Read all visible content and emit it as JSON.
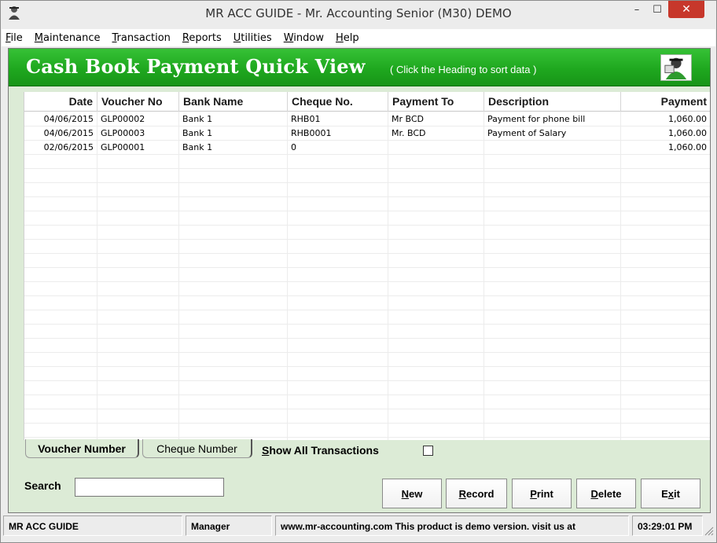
{
  "window": {
    "title": "MR ACC GUIDE - Mr. Accounting Senior (M30) DEMO",
    "minimize_glyph": "–",
    "maximize_glyph": "☐",
    "close_glyph": "✕"
  },
  "menu": [
    {
      "label": "File",
      "accel": "F",
      "rest": "ile"
    },
    {
      "label": "Maintenance",
      "accel": "M",
      "rest": "aintenance"
    },
    {
      "label": "Transaction",
      "accel": "T",
      "rest": "ransaction"
    },
    {
      "label": "Reports",
      "accel": "R",
      "rest": "eports"
    },
    {
      "label": "Utilities",
      "accel": "U",
      "rest": "tilities"
    },
    {
      "label": "Window",
      "accel": "W",
      "rest": "indow"
    },
    {
      "label": "Help",
      "accel": "H",
      "rest": "elp"
    }
  ],
  "header": {
    "title": "Cash Book Payment Quick View",
    "hint": "( Click the Heading to sort data )",
    "icon": "user-agent-icon"
  },
  "table": {
    "columns": [
      "Date",
      "Voucher No",
      "Bank Name",
      "Cheque No.",
      "Payment To",
      "Description",
      "Payment"
    ],
    "rows": [
      [
        "04/06/2015",
        "GLP00002",
        "Bank 1",
        "RHB01",
        "Mr BCD",
        "Payment for phone bill",
        "1,060.00"
      ],
      [
        "04/06/2015",
        "GLP00003",
        "Bank 1",
        "RHB0001",
        "Mr. BCD",
        "Payment of Salary",
        "1,060.00"
      ],
      [
        "02/06/2015",
        "GLP00001",
        "Bank 1",
        "0",
        "",
        "",
        "1,060.00"
      ]
    ]
  },
  "tabs": {
    "voucher": "Voucher Number",
    "cheque": "Cheque Number"
  },
  "show_all": {
    "label": "Show All Transactions",
    "accel": "S",
    "rest": "how All Transactions",
    "checked": false
  },
  "search": {
    "label": "Search",
    "value": ""
  },
  "buttons": {
    "new": {
      "accel": "N",
      "rest": "ew"
    },
    "record": {
      "accel": "R",
      "rest": "ecord"
    },
    "print": {
      "accel": "P",
      "rest": "rint"
    },
    "delete": {
      "accel": "D",
      "rest": "elete"
    },
    "exit": {
      "pre": "E",
      "accel": "x",
      "rest": "it"
    }
  },
  "status": {
    "app": "MR ACC GUIDE",
    "user": "Manager",
    "message": "www.mr-accounting.com This product is demo version.  visit us at",
    "time": "03:29:01 PM"
  },
  "colors": {
    "header_green": "#1fa81f",
    "panel_green": "#dcebd6",
    "close_red": "#c7372b"
  }
}
